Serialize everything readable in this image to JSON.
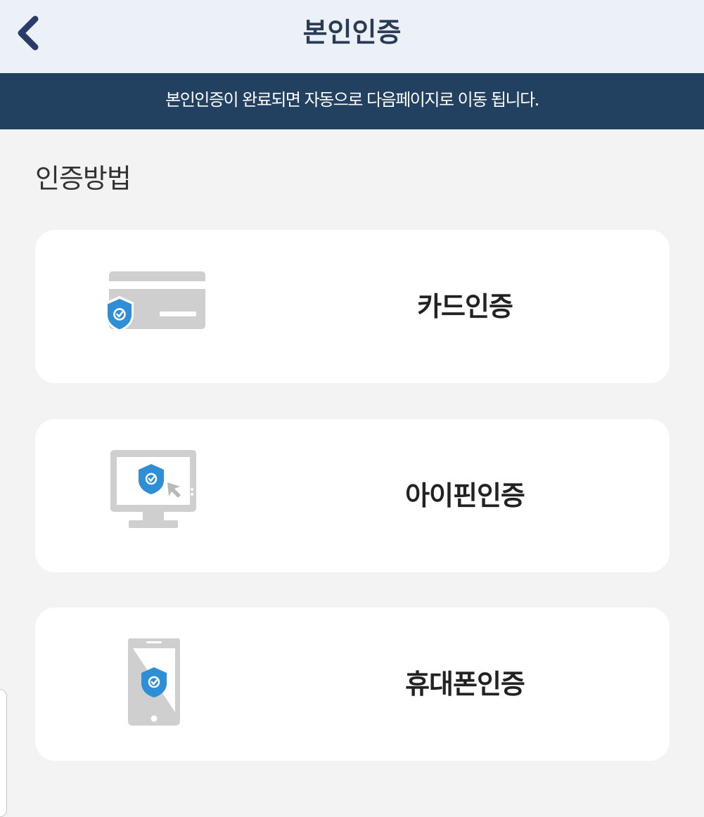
{
  "header": {
    "title": "본인인증",
    "back_icon": "chevron-left-icon"
  },
  "notice": {
    "text": "본인인증이 완료되면 자동으로 다음페이지로 이동 됩니다."
  },
  "section": {
    "title": "인증방법"
  },
  "methods": [
    {
      "label": "카드인증",
      "icon": "credit-card-shield-icon"
    },
    {
      "label": "아이핀인증",
      "icon": "monitor-shield-icon"
    },
    {
      "label": "휴대폰인증",
      "icon": "smartphone-shield-icon"
    }
  ],
  "colors": {
    "header_bg": "#ecf1f8",
    "notice_bg": "#22405f",
    "shield_blue": "#2f8fd6",
    "icon_gray": "#cfcfcf"
  }
}
